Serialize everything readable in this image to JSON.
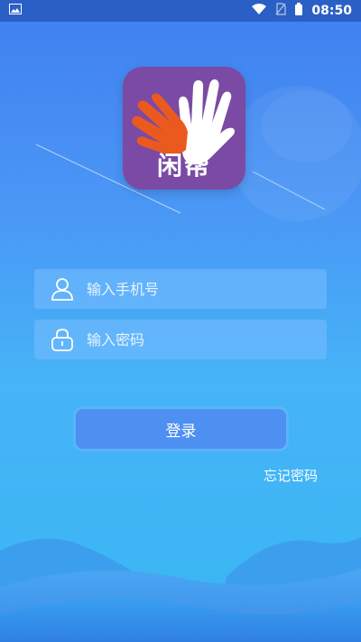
{
  "status_bar": {
    "time": "08:50",
    "icons": [
      "image-icon",
      "wifi-icon",
      "no-sim-icon",
      "battery-icon"
    ]
  },
  "logo": {
    "text": "闲帮"
  },
  "form": {
    "phone_placeholder": "输入手机号",
    "password_placeholder": "输入密码",
    "login_label": "登录",
    "forgot_label": "忘记密码"
  },
  "colors": {
    "status_bar": "#2a5fc6",
    "logo_bg": "#7a4aa4",
    "button": "#4e8ff2"
  }
}
